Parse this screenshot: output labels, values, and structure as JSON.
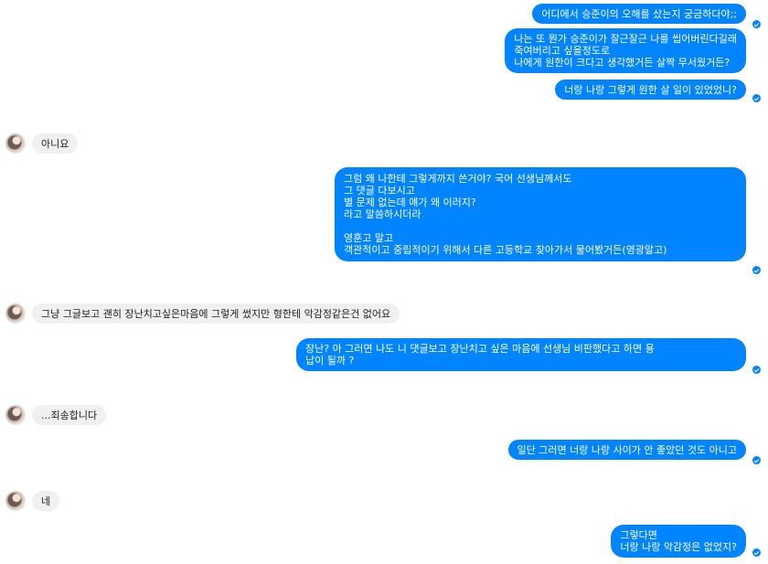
{
  "messages": {
    "m1": "어디에서 승준이의 오해를 샀는지 궁금하다야;;",
    "m2": "나는 또 뭔가 승준이가 잘근잘근 나를 씹어버린다길래\n죽여버리고 싶을정도로\n나에게 원한이 크다고 생각했거든 살짝 무서웠거든?",
    "m3": "너랑 나랑 그렇게 원한 살 일이 있었었니?",
    "r1": "아니요",
    "m4": "그럼 왜 나한테 그렇게까지 쓴거야? 국어 선생님께서도\n그 댓글 다보시고\n별 문제 없는데 얘가 왜 이러지?\n라고 말씀하시더라\n\n영훈고 말고\n객관적이고 중립적이기 위해서 다른 고등학교 찾아가서 물어봤거든(영광말고)",
    "r2": "그냥 그글보고 괜히 장난치고싶은마음에 그렇게 썼지만 형한테 악감정같은건 없어요",
    "m5": "장난? 아 그러면 나도 니 댓글보고 장난치고 싶은 마음에 선생님 비판했다고 하면 용\n납이 될까 ?",
    "r3": "...죄송합니다",
    "m6": "일단 그러면 너랑 나랑 사이가 안 좋았던 것도 아니고",
    "r4": "네",
    "m7": "그렇다면\n너랑 나랑 악감정은 없었지?"
  }
}
